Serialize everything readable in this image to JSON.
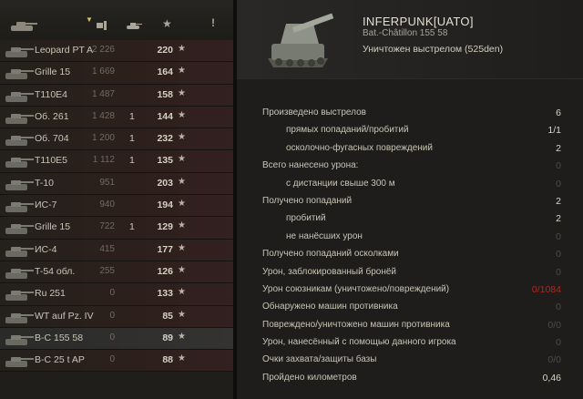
{
  "header": {
    "icons": [
      "tank-type-icon",
      "sort-arrow-icon",
      "damage-column-icon",
      "kills-column-icon",
      "xp-star-icon",
      "info-icon"
    ]
  },
  "players": [
    {
      "name": "Leopard PT A",
      "damage": "2 226",
      "kills": "",
      "xp": "220"
    },
    {
      "name": "Grille 15",
      "damage": "1 669",
      "kills": "",
      "xp": "164"
    },
    {
      "name": "T110E4",
      "damage": "1 487",
      "kills": "",
      "xp": "158"
    },
    {
      "name": "Об. 261",
      "damage": "1 428",
      "kills": "1",
      "xp": "144"
    },
    {
      "name": "Об. 704",
      "damage": "1 200",
      "kills": "1",
      "xp": "232"
    },
    {
      "name": "T110E5",
      "damage": "1 112",
      "kills": "1",
      "xp": "135"
    },
    {
      "name": "T-10",
      "damage": "951",
      "kills": "",
      "xp": "203"
    },
    {
      "name": "ИС-7",
      "damage": "940",
      "kills": "",
      "xp": "194"
    },
    {
      "name": "Grille 15",
      "damage": "722",
      "kills": "1",
      "xp": "129"
    },
    {
      "name": "ИС-4",
      "damage": "415",
      "kills": "",
      "xp": "177"
    },
    {
      "name": "T-54 обл.",
      "damage": "255",
      "kills": "",
      "xp": "126"
    },
    {
      "name": "Ru 251",
      "damage": "0",
      "kills": "",
      "xp": "133"
    },
    {
      "name": "WT auf Pz. IV",
      "damage": "0",
      "kills": "",
      "xp": "85"
    },
    {
      "name": "B-C 155 58",
      "damage": "0",
      "kills": "",
      "xp": "89"
    },
    {
      "name": "B-C 25 t AP",
      "damage": "0",
      "kills": "",
      "xp": "88"
    }
  ],
  "detail": {
    "player_name": "INFERPUNK[UATO]",
    "vehicle": "Bat.-Châtillon 155 58",
    "status": "Уничтожен выстрелом (525den)"
  },
  "stats": [
    {
      "label": "Произведено выстрелов",
      "value": "6",
      "indent": false,
      "style": "normal"
    },
    {
      "label": "прямых попаданий/пробитий",
      "value": "1/1",
      "indent": true,
      "style": "normal"
    },
    {
      "label": "осколочно-фугасных повреждений",
      "value": "2",
      "indent": true,
      "style": "normal"
    },
    {
      "label": "Всего нанесено урона:",
      "value": "0",
      "indent": false,
      "style": "dim"
    },
    {
      "label": "с дистанции свыше 300 м",
      "value": "0",
      "indent": true,
      "style": "dim"
    },
    {
      "label": "Получено попаданий",
      "value": "2",
      "indent": false,
      "style": "normal"
    },
    {
      "label": "пробитий",
      "value": "2",
      "indent": true,
      "style": "normal"
    },
    {
      "label": "не нанёсших урон",
      "value": "0",
      "indent": true,
      "style": "dim"
    },
    {
      "label": "Получено попаданий осколками",
      "value": "0",
      "indent": false,
      "style": "dim"
    },
    {
      "label": "Урон, заблокированный бронёй",
      "value": "0",
      "indent": false,
      "style": "dim"
    },
    {
      "label": "Урон союзникам (уничтожено/повреждений)",
      "value": "0/1084",
      "indent": false,
      "style": "red"
    },
    {
      "label": "Обнаружено машин противника",
      "value": "0",
      "indent": false,
      "style": "dim"
    },
    {
      "label": "Повреждено/уничтожено машин противника",
      "value": "0/0",
      "indent": false,
      "style": "dim"
    },
    {
      "label": "Урон, нанесённый с помощью данного игрока",
      "value": "0",
      "indent": false,
      "style": "dim"
    },
    {
      "label": "Очки захвата/защиты базы",
      "value": "0/0",
      "indent": false,
      "style": "dim"
    },
    {
      "label": "Пройдено километров",
      "value": "0,46",
      "indent": false,
      "style": "normal"
    }
  ],
  "ui": {
    "star": "★",
    "me_index": 13
  }
}
